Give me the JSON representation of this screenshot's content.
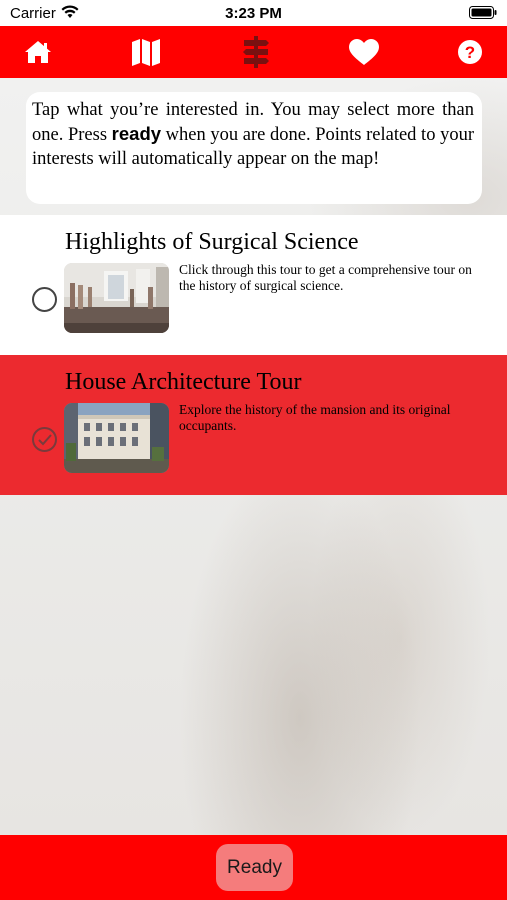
{
  "status_bar": {
    "carrier": "Carrier",
    "time": "3:23 PM",
    "icons": [
      "wifi-icon",
      "battery-icon"
    ]
  },
  "nav_bar": {
    "color": "#ff0000",
    "icons": [
      "home-icon",
      "map-icon",
      "signpost-icon",
      "heart-icon",
      "help-icon"
    ]
  },
  "intro": {
    "text_before": "Tap what you’re interested in. You may select more than one. Press ",
    "ready_word": "ready",
    "text_after": " when you are done. Points related to your interests will automatically appear on the map!"
  },
  "tours": [
    {
      "title": "Highlights of Surgical Science",
      "description": "Click through this tour to get a comprehensive tour on the history of surgical science.",
      "selected": false
    },
    {
      "title": "House Architecture Tour",
      "description": "Explore the history of the mansion and its original occupants.",
      "selected": true
    }
  ],
  "colors": {
    "selected_row": "#ec2a2f",
    "bottom_bar": "#ff0000",
    "ready_button": "#f57c7c"
  },
  "footer": {
    "ready_label": "Ready"
  }
}
